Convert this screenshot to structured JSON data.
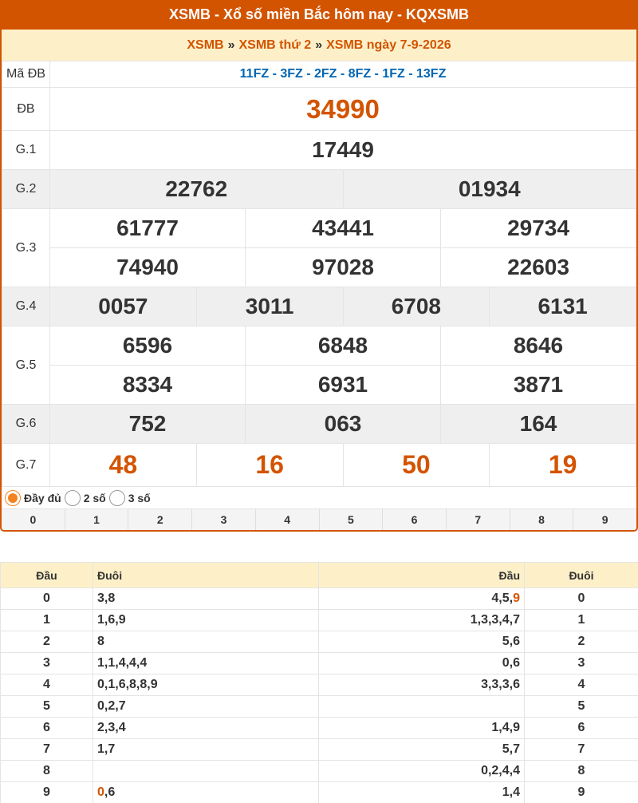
{
  "header": {
    "title": "XSMB - Xổ số miền Bắc hôm nay - KQXSMB"
  },
  "breadcrumb": {
    "item1": "XSMB",
    "sep": "»",
    "item2": "XSMB thứ 2",
    "item3": "XSMB ngày 7-9-2026"
  },
  "results": {
    "madb_label": "Mã ĐB",
    "madb_value": "11FZ - 3FZ - 2FZ - 8FZ - 1FZ - 13FZ",
    "db_label": "ĐB",
    "db": "34990",
    "g1_label": "G.1",
    "g1": [
      "17449"
    ],
    "g2_label": "G.2",
    "g2": [
      "22762",
      "01934"
    ],
    "g3_label": "G.3",
    "g3": [
      "61777",
      "43441",
      "29734",
      "74940",
      "97028",
      "22603"
    ],
    "g4_label": "G.4",
    "g4": [
      "0057",
      "3011",
      "6708",
      "6131"
    ],
    "g5_label": "G.5",
    "g5": [
      "6596",
      "6848",
      "8646",
      "8334",
      "6931",
      "3871"
    ],
    "g6_label": "G.6",
    "g6": [
      "752",
      "063",
      "164"
    ],
    "g7_label": "G.7",
    "g7": [
      "48",
      "16",
      "50",
      "19"
    ]
  },
  "options": {
    "full": "Đầy đủ",
    "two": "2 số",
    "three": "3 số",
    "selected": "full"
  },
  "digits": [
    "0",
    "1",
    "2",
    "3",
    "4",
    "5",
    "6",
    "7",
    "8",
    "9"
  ],
  "loto": {
    "headers": {
      "dau": "Đầu",
      "duoi": "Đuôi",
      "dau2": "Đầu",
      "duoi2": "Đuôi"
    },
    "rows": [
      {
        "d": "0",
        "tails": "3,8",
        "heads": "4,5,",
        "heads_hl": "9"
      },
      {
        "d": "1",
        "tails": "1,6,9",
        "heads": "1,3,3,4,7",
        "heads_hl": ""
      },
      {
        "d": "2",
        "tails": "8",
        "heads": "5,6",
        "heads_hl": ""
      },
      {
        "d": "3",
        "tails": "1,1,4,4,4",
        "heads": "0,6",
        "heads_hl": ""
      },
      {
        "d": "4",
        "tails": "0,1,6,8,8,9",
        "heads": "3,3,3,6",
        "heads_hl": ""
      },
      {
        "d": "5",
        "tails": "0,2,7",
        "heads": "",
        "heads_hl": ""
      },
      {
        "d": "6",
        "tails": "2,3,4",
        "heads": "1,4,9",
        "heads_hl": ""
      },
      {
        "d": "7",
        "tails": "1,7",
        "heads": "5,7",
        "heads_hl": ""
      },
      {
        "d": "8",
        "tails": "",
        "heads": "0,2,4,4",
        "heads_hl": ""
      },
      {
        "d": "9",
        "tails_hl": "0",
        "tails": ",6",
        "heads": "1,4",
        "heads_hl": ""
      }
    ]
  },
  "colors": {
    "brand": "#d35400",
    "header_bg": "#fdf0c8",
    "madb": "#0066b3"
  }
}
